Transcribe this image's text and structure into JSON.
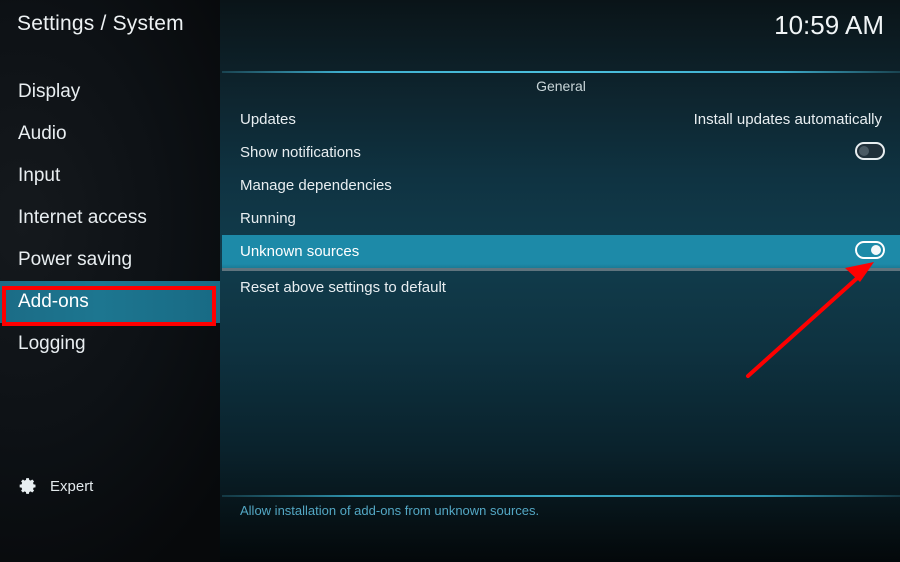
{
  "window": {
    "title": "Settings / System",
    "clock": "10:59 AM"
  },
  "sidebar": {
    "items": [
      {
        "label": "Display",
        "selected": false
      },
      {
        "label": "Audio",
        "selected": false
      },
      {
        "label": "Input",
        "selected": false
      },
      {
        "label": "Internet access",
        "selected": false
      },
      {
        "label": "Power saving",
        "selected": false
      },
      {
        "label": "Add-ons",
        "selected": true
      },
      {
        "label": "Logging",
        "selected": false
      }
    ],
    "level_button": {
      "label": "Expert",
      "icon": "gear-icon"
    }
  },
  "main": {
    "section_title": "General",
    "rows": [
      {
        "label": "Updates",
        "value": "Install updates automatically",
        "control": "text",
        "selected": false
      },
      {
        "label": "Show notifications",
        "value": "",
        "control": "toggle",
        "toggle_state": "off",
        "selected": false
      },
      {
        "label": "Manage dependencies",
        "value": "",
        "control": "none",
        "selected": false
      },
      {
        "label": "Running",
        "value": "",
        "control": "none",
        "selected": false
      },
      {
        "label": "Unknown sources",
        "value": "",
        "control": "toggle",
        "toggle_state": "on",
        "selected": true
      },
      {
        "label": "Reset above settings to default",
        "value": "",
        "control": "none",
        "selected": false
      }
    ],
    "help_text": "Allow installation of add-ons from unknown sources."
  },
  "annotations": {
    "highlight_rect_target": "sidebar-item-add-ons",
    "arrow_target": "unknown-sources-toggle",
    "color": "#fe0000"
  },
  "colors": {
    "accent_teal": "#1d8aa8",
    "selected_nav": "#1d7690",
    "help_blue": "#53a7c4",
    "annotation_red": "#fe0000",
    "sidebar_bg": "#0d1115"
  }
}
